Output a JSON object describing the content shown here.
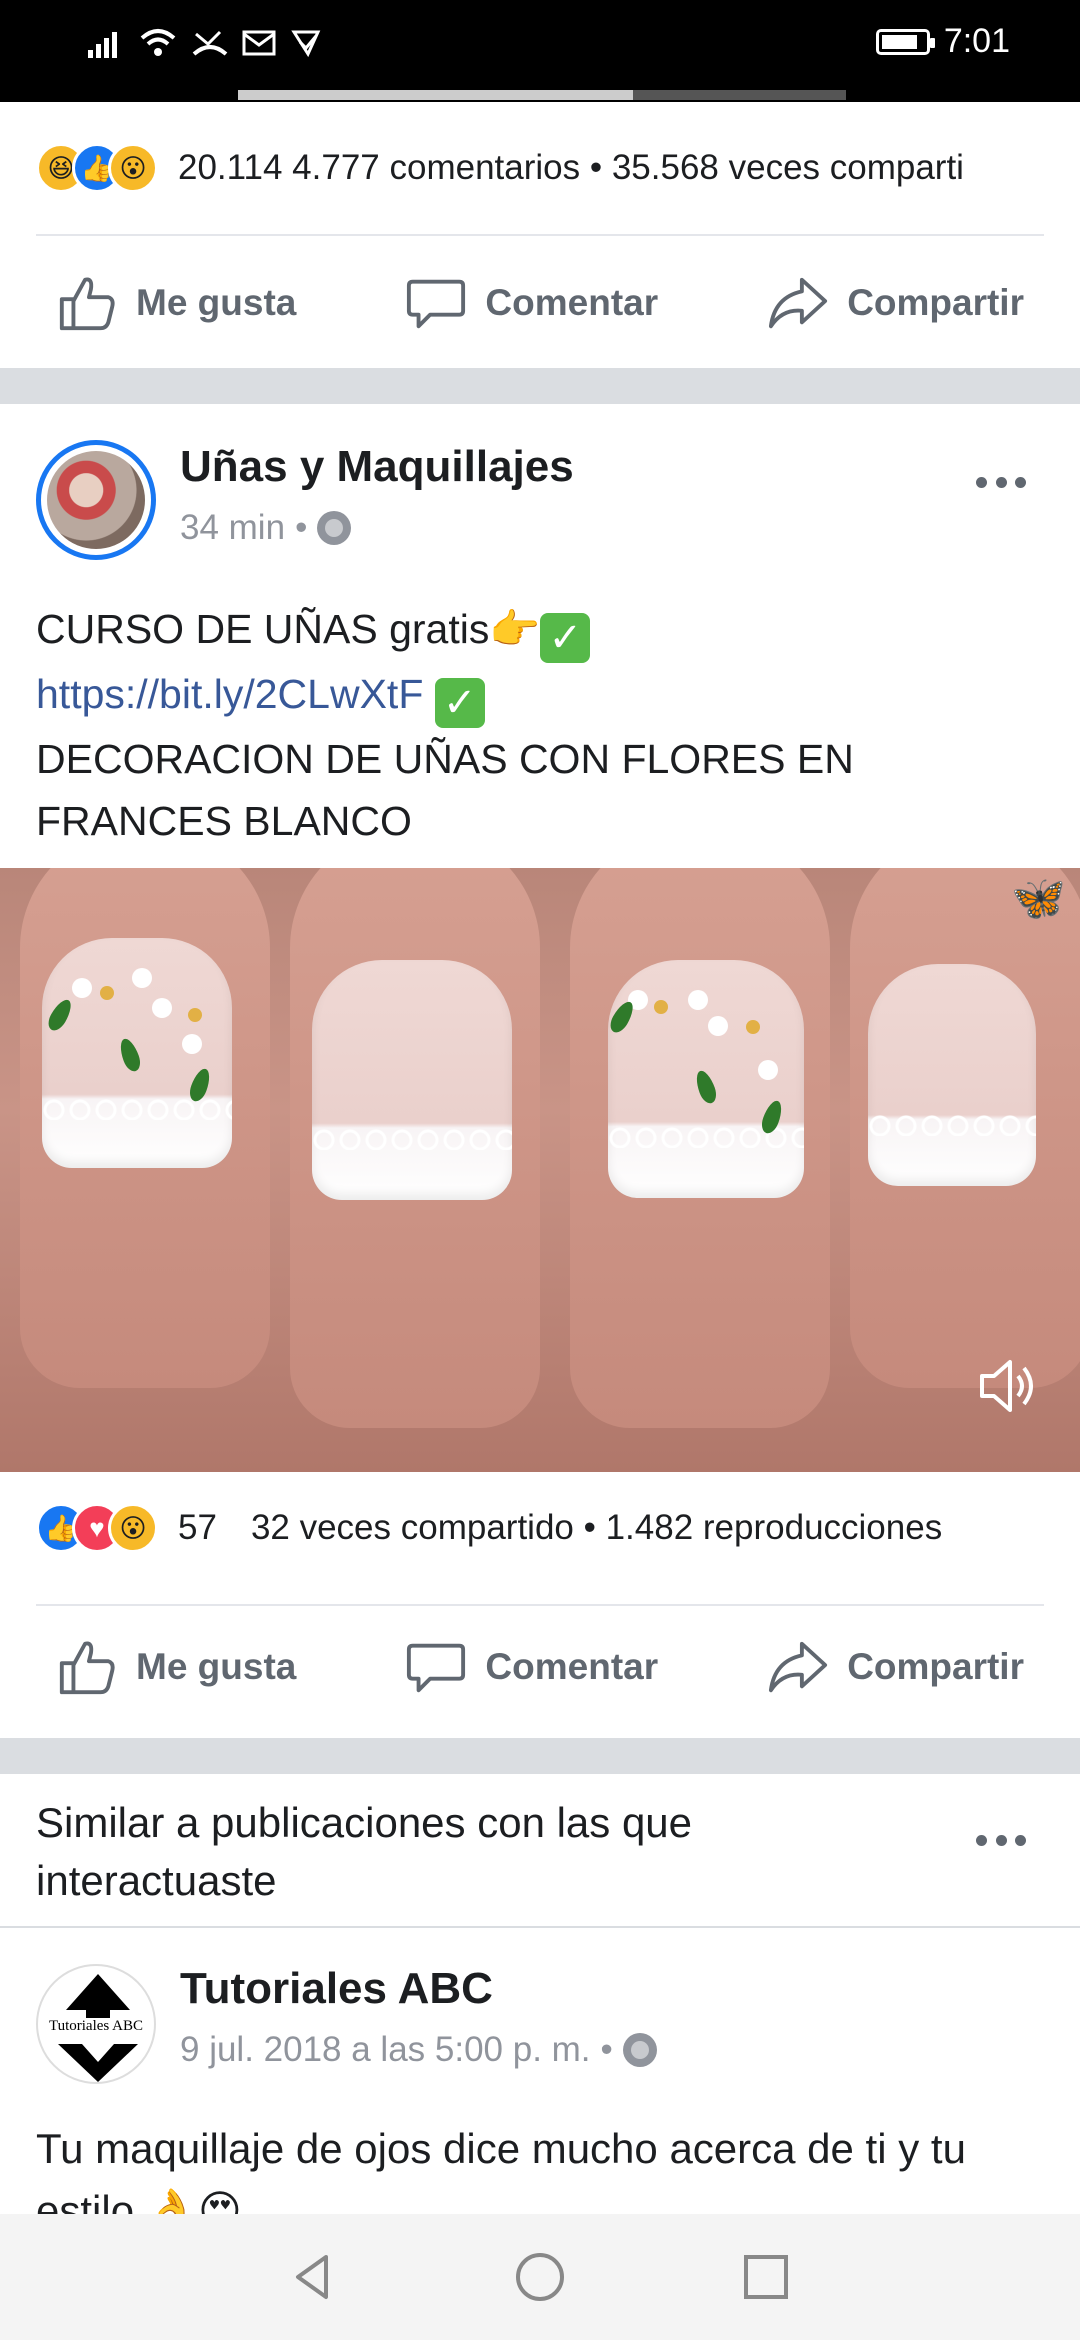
{
  "status_bar": {
    "time": "7:01",
    "battery_level": 0.85,
    "icons": [
      "signal-icon",
      "wifi-icon",
      "missed-call-icon",
      "mail-icon",
      "check-icon"
    ]
  },
  "video_progress": 0.65,
  "post_prev": {
    "reactions": [
      "haha",
      "like",
      "wow"
    ],
    "summary": "20.114 4.777 comentarios • 35.568 veces comparti",
    "actions": {
      "like": "Me gusta",
      "comment": "Comentar",
      "share": "Compartir"
    }
  },
  "post_main": {
    "page_name": "Uñas y Maquillajes",
    "time": "34 min",
    "separator": "•",
    "text_line1": "CURSO DE UÑAS gratis",
    "emoji_point": "👉",
    "link": "https://bit.ly/2CLwXtF",
    "text_line3": "DECORACION DE UÑAS CON FLORES EN FRANCES BLANCO",
    "reactions": [
      "like",
      "love",
      "wow"
    ],
    "reaction_count": "57",
    "stats": "32 veces compartido • 1.482 reproducciones",
    "actions": {
      "like": "Me gusta",
      "comment": "Comentar",
      "share": "Compartir"
    }
  },
  "similar": {
    "title": "Similar a publicaciones con las que interactuaste"
  },
  "post_next": {
    "page_name": "Tutoriales ABC",
    "avatar_label": "Tutoriales ABC",
    "date": "9 jul. 2018 a las 5:00 p. m.",
    "separator": "•",
    "text": "Tu maquillaje de ojos dice mucho acerca de ti y tu estilo 👌😍"
  },
  "colors": {
    "facebook_blue": "#1877f2",
    "link": "#385898",
    "secondary_text": "#90949c",
    "action_text": "#606770"
  }
}
